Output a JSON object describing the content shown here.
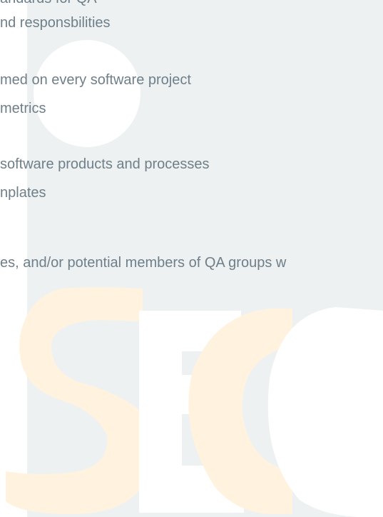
{
  "slide": {
    "lines": [
      "andards for QA",
      "nd responsbilities",
      "med on every software project",
      " metrics",
      "software products and processes",
      "nplates",
      "es, and/or potential members of QA groups w"
    ]
  },
  "colors": {
    "panel_bg": "#eef1f1",
    "text": "#6f7f89",
    "logo_orange": "#fff3e0",
    "logo_white": "#ffffff"
  }
}
